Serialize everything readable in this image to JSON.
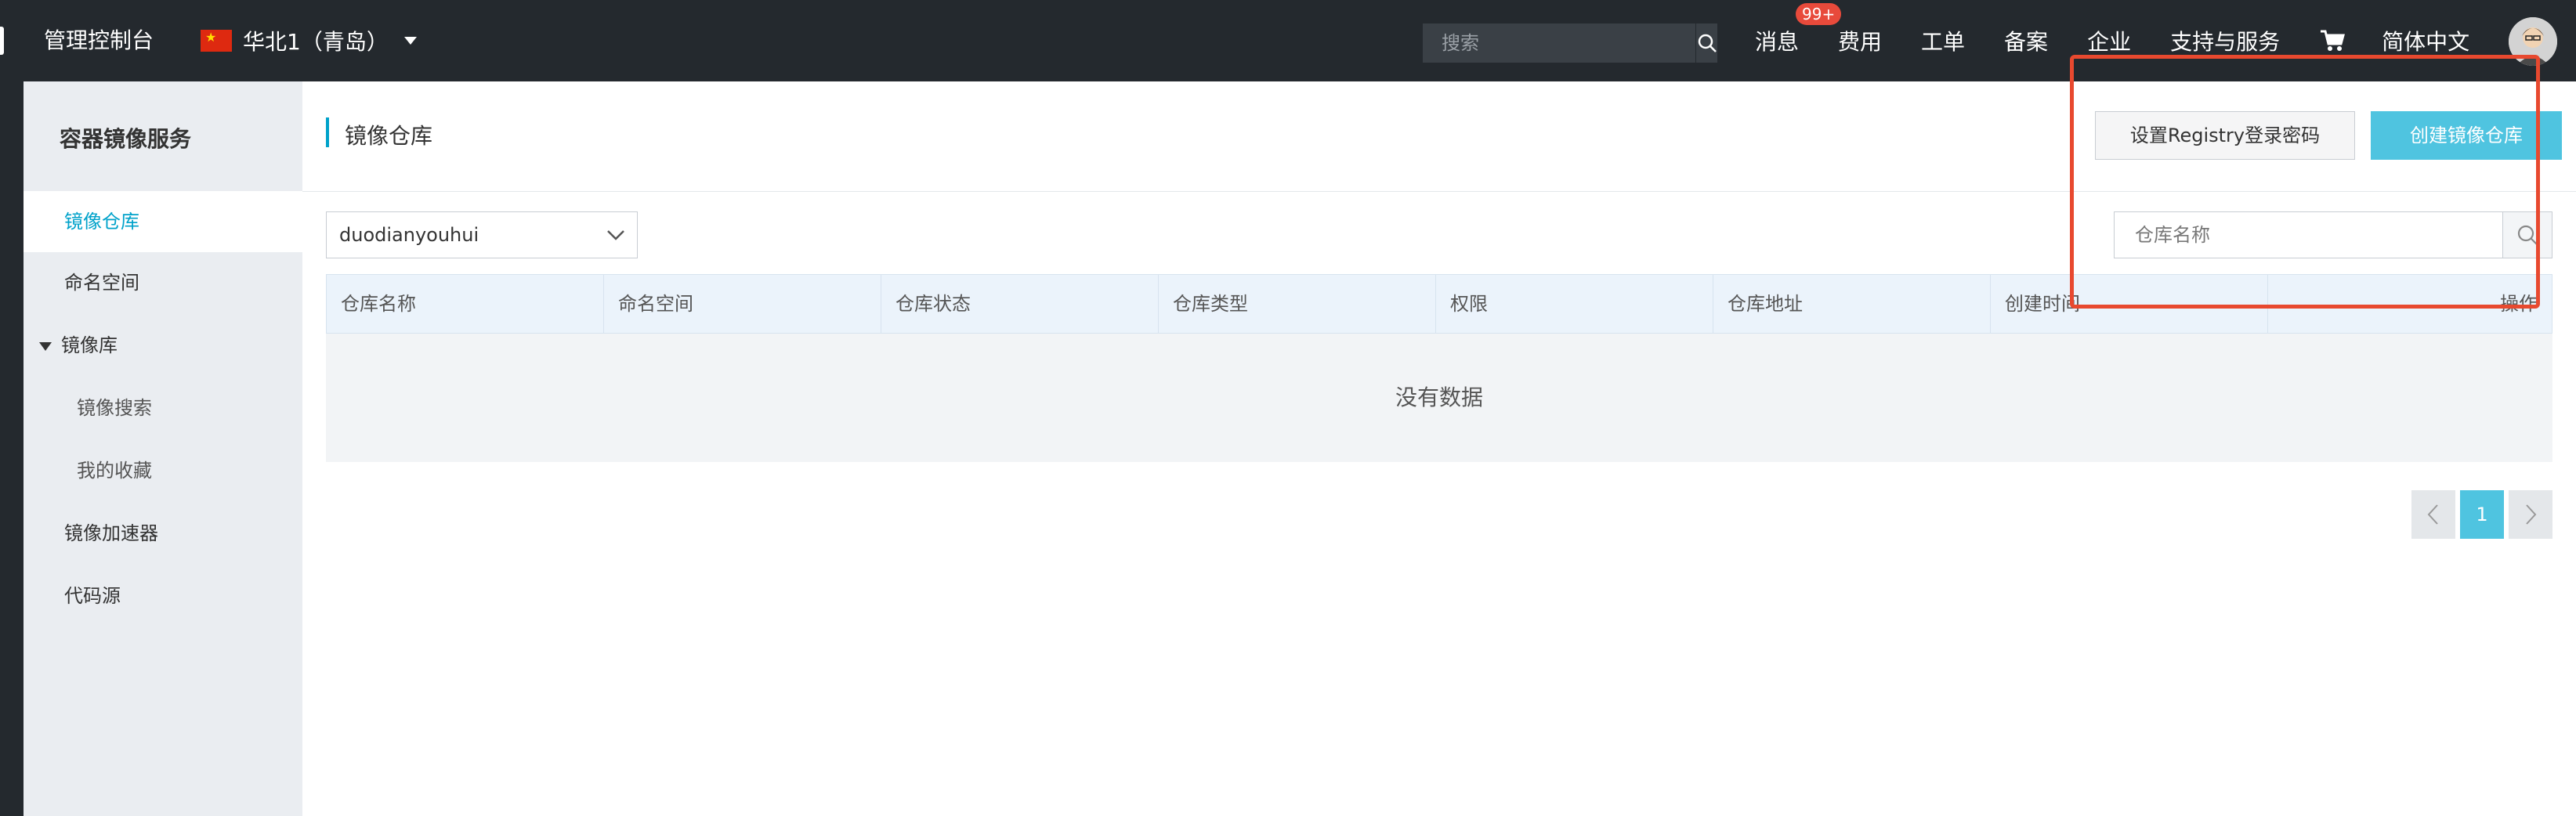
{
  "topbar": {
    "console_label": "管理控制台",
    "region_label": "华北1（青岛）",
    "search_placeholder": "搜索",
    "nav": [
      {
        "label": "消息",
        "badge": "99+"
      },
      {
        "label": "费用"
      },
      {
        "label": "工单"
      },
      {
        "label": "备案"
      },
      {
        "label": "企业"
      },
      {
        "label": "支持与服务"
      },
      {
        "label": "简体中文"
      }
    ],
    "icons": {
      "search": "search-icon",
      "cart": "cart-icon",
      "flag": "china-flag-icon",
      "avatar": "avatar"
    }
  },
  "sidebar": {
    "title": "容器镜像服务",
    "items": [
      {
        "label": "镜像仓库",
        "active": true
      },
      {
        "label": "命名空间"
      },
      {
        "label": "镜像库",
        "expanded": true
      },
      {
        "label": "镜像搜索",
        "sub": true
      },
      {
        "label": "我的收藏",
        "sub": true
      },
      {
        "label": "镜像加速器"
      },
      {
        "label": "代码源"
      }
    ]
  },
  "main": {
    "page_title": "镜像仓库",
    "buttons": {
      "set_password": "设置Registry登录密码",
      "create_repo": "创建镜像仓库"
    },
    "namespace_select": {
      "value": "duodianyouhui"
    },
    "repo_search": {
      "placeholder": "仓库名称"
    },
    "table": {
      "columns": [
        "仓库名称",
        "命名空间",
        "仓库状态",
        "仓库类型",
        "权限",
        "仓库地址",
        "创建时间",
        "操作"
      ],
      "empty_text": "没有数据"
    },
    "pagination": {
      "current_page": "1"
    }
  },
  "colors": {
    "topbar": "#24292e",
    "accent": "#00a2ca",
    "primary_button": "#4fc4e0",
    "annotation": "#e8492f",
    "badge": "#e84a3b"
  }
}
